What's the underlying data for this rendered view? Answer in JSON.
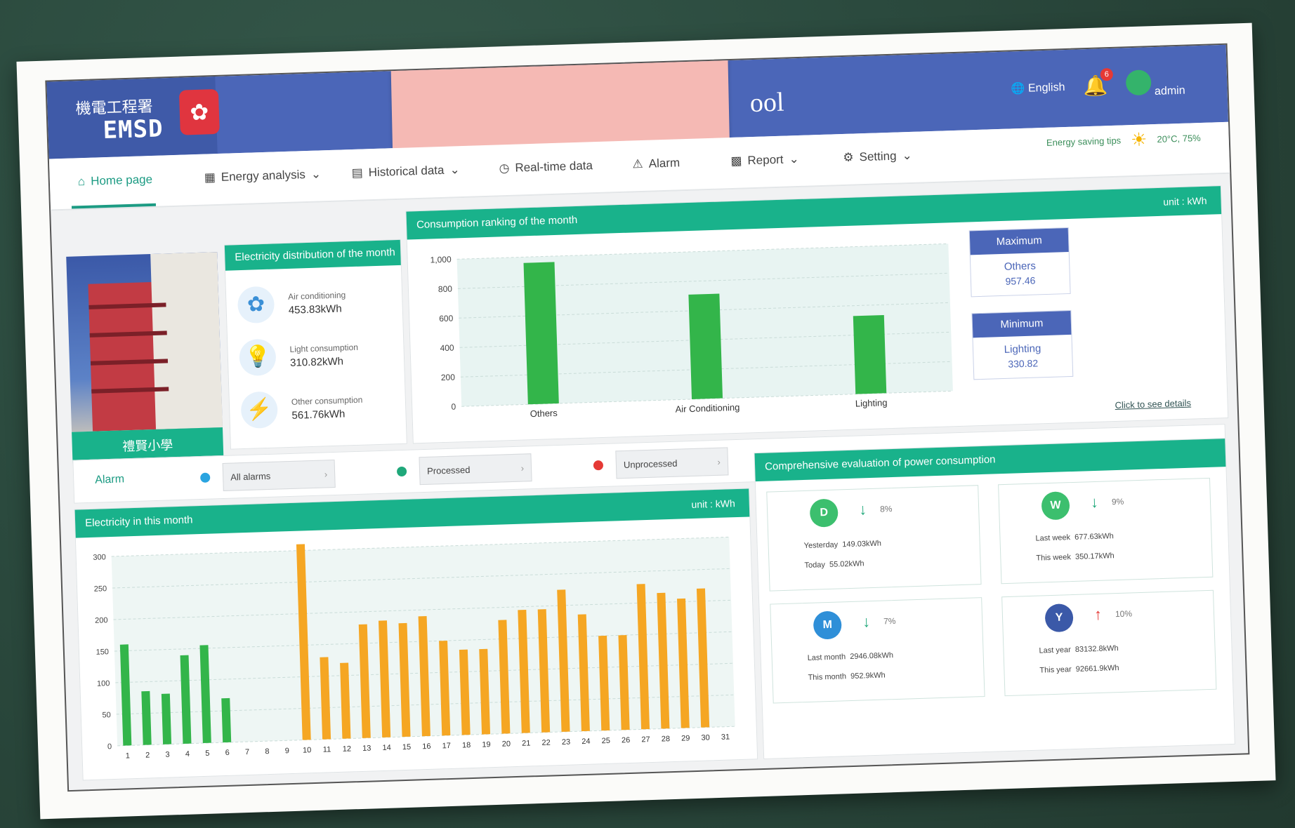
{
  "header": {
    "logo_zh": "機電工程署",
    "logo_en": "EMSD",
    "title_suffix": "ool",
    "language": "English",
    "notifications": "6",
    "user": "admin",
    "sub_status": "Energy saving tips",
    "weather": "20°C, 75%"
  },
  "nav": {
    "items": [
      {
        "label": "Home page",
        "icon": "home-icon"
      },
      {
        "label": "Energy analysis",
        "icon": "grid-icon"
      },
      {
        "label": "Historical data",
        "icon": "database-icon"
      },
      {
        "label": "Real-time data",
        "icon": "clock-icon"
      },
      {
        "label": "Alarm",
        "icon": "alarm-icon"
      },
      {
        "label": "Report",
        "icon": "report-icon"
      },
      {
        "label": "Setting",
        "icon": "gear-icon"
      }
    ]
  },
  "building": {
    "caption": "禮賢小學"
  },
  "distribution": {
    "title": "Electricity distribution of the month",
    "items": [
      {
        "label": "Air conditioning",
        "value": "453.83kWh",
        "icon": "fan-icon"
      },
      {
        "label": "Light consumption",
        "value": "310.82kWh",
        "icon": "bulb-icon"
      },
      {
        "label": "Other consumption",
        "value": "561.76kWh",
        "icon": "bolt-icon"
      }
    ]
  },
  "ranking": {
    "title": "Consumption ranking of the month",
    "unit": "unit : kWh",
    "click_label": "Click to see details"
  },
  "maximum": {
    "header": "Maximum",
    "category": "Others",
    "value": "957.46"
  },
  "minimum": {
    "header": "Minimum",
    "category": "Lighting",
    "value": "330.82"
  },
  "alarm": {
    "title": "Alarm",
    "filters": [
      {
        "label": "All alarms",
        "color": "#2aa4e0"
      },
      {
        "label": "Processed",
        "color": "#1fa87a"
      },
      {
        "label": "Unprocessed",
        "color": "#e53935"
      }
    ]
  },
  "daily": {
    "title": "Electricity in this month",
    "unit": "unit : kWh"
  },
  "evaluation": {
    "title": "Comprehensive evaluation of power consumption",
    "cards": [
      {
        "letter": "D",
        "arrow": "↓",
        "pct": "8%",
        "line1_label": "Yesterday",
        "line1_value": "149.03kWh",
        "line2_label": "Today",
        "line2_value": "55.02kWh",
        "color": "#3cbf6e",
        "arrow_color": "#1fa87a"
      },
      {
        "letter": "W",
        "arrow": "↓",
        "pct": "9%",
        "line1_label": "Last week",
        "line1_value": "677.63kWh",
        "line2_label": "This week",
        "line2_value": "350.17kWh",
        "color": "#3cbf6e",
        "arrow_color": "#1fa87a"
      },
      {
        "letter": "M",
        "arrow": "↓",
        "pct": "7%",
        "line1_label": "Last month",
        "line1_value": "2946.08kWh",
        "line2_label": "This month",
        "line2_value": "952.9kWh",
        "color": "#2f8fd8",
        "arrow_color": "#1fa87a"
      },
      {
        "letter": "Y",
        "arrow": "↑",
        "pct": "10%",
        "line1_label": "Last year",
        "line1_value": "83132.8kWh",
        "line2_label": "This year",
        "line2_value": "92661.9kWh",
        "color": "#3b59a8",
        "arrow_color": "#e53935"
      }
    ]
  },
  "chart_data": [
    {
      "type": "bar",
      "categories": [
        "Others",
        "Air Conditioning",
        "Lighting"
      ],
      "values": [
        960,
        710,
        530
      ],
      "ylim": [
        0,
        1000
      ],
      "yticks": [
        "0",
        "200",
        "400",
        "600",
        "800",
        "1,000"
      ],
      "color": "#33b54a"
    },
    {
      "type": "bar",
      "categories": [
        "1",
        "2",
        "3",
        "4",
        "5",
        "6",
        "7",
        "8",
        "9",
        "10",
        "11",
        "12",
        "13",
        "14",
        "15",
        "16",
        "17",
        "18",
        "19",
        "20",
        "21",
        "22",
        "23",
        "24",
        "25",
        "26",
        "27",
        "28",
        "29",
        "30",
        "31"
      ],
      "values": [
        160,
        85,
        80,
        140,
        155,
        70,
        0,
        0,
        0,
        310,
        130,
        120,
        180,
        185,
        180,
        190,
        150,
        135,
        135,
        180,
        195,
        195,
        225,
        185,
        150,
        150,
        230,
        215,
        205,
        220,
        0
      ],
      "ylim": [
        0,
        300
      ],
      "yticks": [
        "0",
        "50",
        "100",
        "150",
        "200",
        "250",
        "300"
      ],
      "colors": {
        "weekend": "#33b54a",
        "weekday": "#f5a623"
      }
    }
  ]
}
